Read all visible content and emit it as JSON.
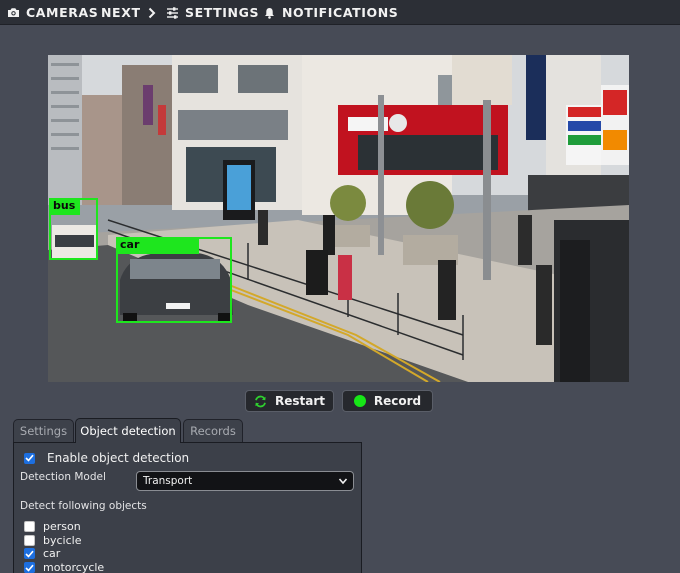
{
  "nav": {
    "cameras": "CAMERAS",
    "next": "NEXT",
    "settings": "SETTINGS",
    "notifications": "NOTIFICATIONS",
    "icons": [
      "camera-icon",
      "chevron-right-icon",
      "sliders-icon",
      "bell-icon"
    ]
  },
  "detections": [
    {
      "label": "bus"
    },
    {
      "label": "car"
    }
  ],
  "controls": {
    "restart": "Restart",
    "record": "Record"
  },
  "tabs": {
    "settings": "Settings",
    "object_detection": "Object detection",
    "records": "Records",
    "active": "Object detection"
  },
  "object_detection": {
    "enable_label": "Enable object detection",
    "enabled": true,
    "model_label": "Detection Model",
    "model_value": "Transport",
    "detect_label": "Detect following objects",
    "objects": [
      {
        "name": "person",
        "checked": false
      },
      {
        "name": "bycicle",
        "checked": false
      },
      {
        "name": "car",
        "checked": true
      },
      {
        "name": "motorcycle",
        "checked": true
      }
    ]
  },
  "colors": {
    "background": "#474b56",
    "topbar": "#2c2f36",
    "detection_box": "#1ee61e",
    "record_dot": "#17e617",
    "checkbox_checked": "#1d6fe0"
  }
}
